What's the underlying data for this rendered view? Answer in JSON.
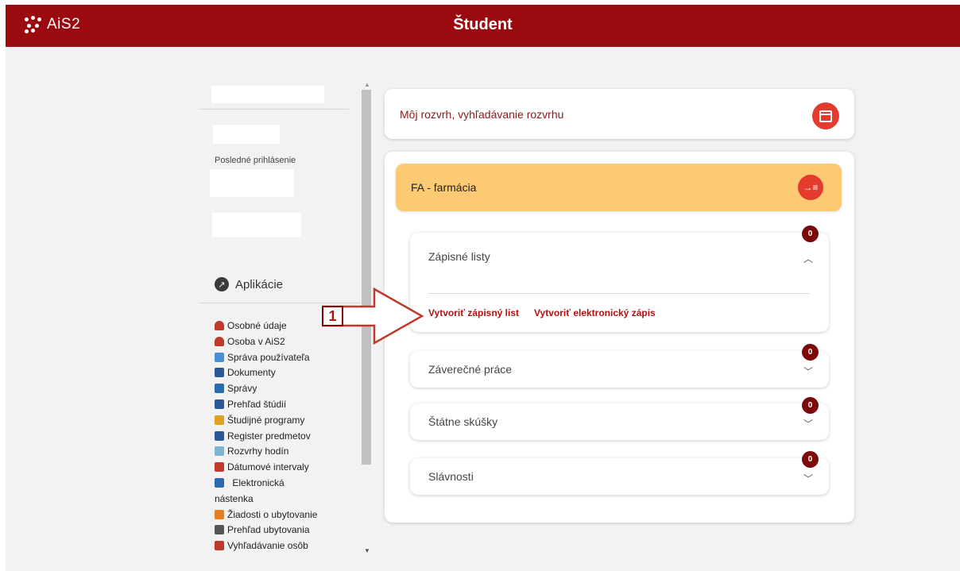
{
  "header": {
    "logo_text": "AiS2",
    "title": "Študent",
    "bar_color": "#9b0a0e"
  },
  "sidebar": {
    "last_login_label": "Posledné prihlásenie",
    "apps_heading": "Aplikácie",
    "apps": [
      {
        "label": "Osobné údaje",
        "icon": "person-icon",
        "color": "#c0392b"
      },
      {
        "label": "Osoba v AiS2",
        "icon": "person-icon",
        "color": "#c0392b"
      },
      {
        "label": "Správa používateľa",
        "icon": "users-tree-icon",
        "color": "#4a90d9"
      },
      {
        "label": "Dokumenty",
        "icon": "document-icon",
        "color": "#2b5797"
      },
      {
        "label": "Správy",
        "icon": "message-icon",
        "color": "#2b6cb0"
      },
      {
        "label": "Prehľad štúdií",
        "icon": "studies-icon",
        "color": "#2b5797"
      },
      {
        "label": "Študijné programy",
        "icon": "list-icon",
        "color": "#e0a020"
      },
      {
        "label": "Register predmetov",
        "icon": "register-icon",
        "color": "#2b5797"
      },
      {
        "label": "Rozvrhy hodín",
        "icon": "timetable-icon",
        "color": "#7fb3d5"
      },
      {
        "label": "Dátumové intervaly",
        "icon": "calendar-icon",
        "color": "#c0392b"
      },
      {
        "label": "Elektronická nástenka",
        "icon": "board-icon",
        "color": "#2b6cb0"
      },
      {
        "label": "Žiadosti o ubytovanie",
        "icon": "accommodation-request-icon",
        "color": "#e67e22"
      },
      {
        "label": "Prehľad ubytovania",
        "icon": "grid-icon",
        "color": "#555555"
      },
      {
        "label": "Vyhľadávanie osôb",
        "icon": "person-search-icon",
        "color": "#c0392b"
      }
    ]
  },
  "main": {
    "schedule_label": "Môj rozvrh, vyhľadávanie rozvrhu",
    "program_label": "FA - farmácia",
    "program_color": "#fdca74",
    "sections": [
      {
        "label": "Zápisné listy",
        "count": "0",
        "expanded": true,
        "actions": [
          "Vytvoriť zápisný list",
          "Vytvoriť elektronický zápis"
        ]
      },
      {
        "label": "Záverečné práce",
        "count": "0",
        "expanded": false
      },
      {
        "label": "Štátne skúšky",
        "count": "0",
        "expanded": false
      },
      {
        "label": "Slávnosti",
        "count": "0",
        "expanded": false
      }
    ]
  },
  "annotation": {
    "number": "1"
  }
}
